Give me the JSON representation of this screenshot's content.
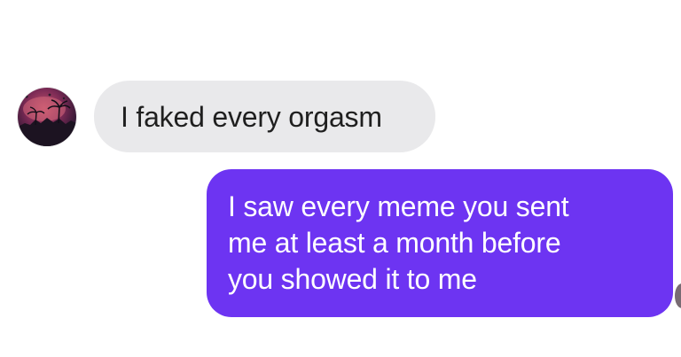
{
  "conversation": {
    "messages": [
      {
        "direction": "incoming",
        "text": "I faked every orgasm"
      },
      {
        "direction": "outgoing",
        "text": "I saw every meme you sent\nme at least a month before\nyou showed it to me"
      }
    ],
    "colors": {
      "incoming_bubble": "#e9e9eb",
      "incoming_text": "#1f1f1f",
      "outgoing_bubble": "#6d34f2",
      "outgoing_text": "#ffffff",
      "background": "#ffffff"
    }
  }
}
